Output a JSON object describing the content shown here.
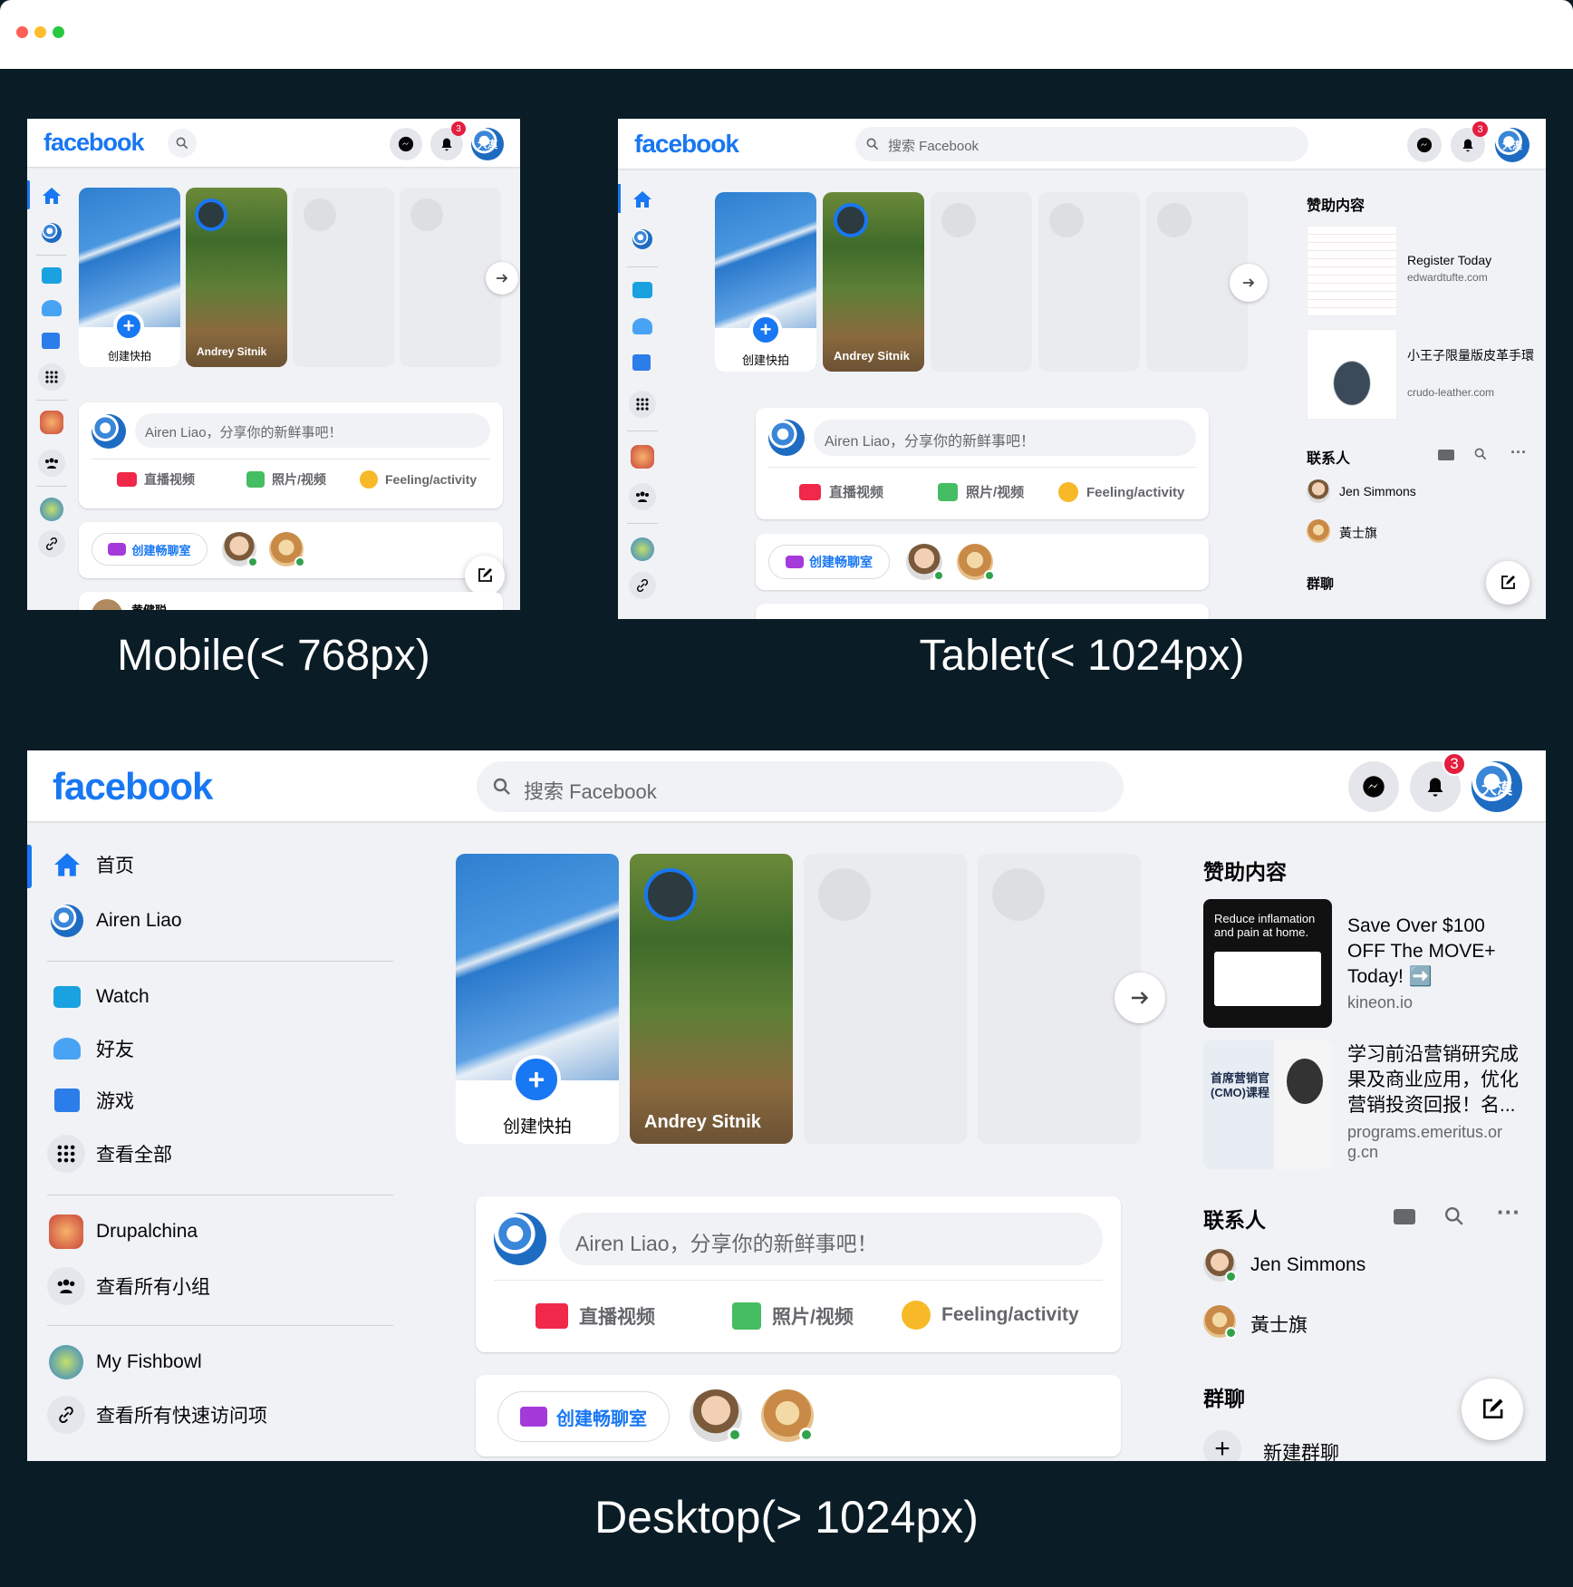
{
  "colors": {
    "brand": "#1877f2",
    "bg_dark": "#0a1c26",
    "page": "#f0f2f5",
    "badge": "#e41e3f",
    "online": "#31a24c"
  },
  "captions": {
    "mobile": "Mobile(< 768px)",
    "tablet": "Tablet(< 1024px)",
    "desktop": "Desktop(> 1024px)"
  },
  "header": {
    "logo": "facebook",
    "search_placeholder": "搜索 Facebook",
    "notif_count": "3",
    "avatar_text": "大漠"
  },
  "stories": {
    "create_label": "创建快拍",
    "friend_name": "Andrey Sitnik"
  },
  "composer": {
    "placeholder": "Airen Liao，分享你的新鲜事吧！",
    "live": "直播视频",
    "photo": "照片/视频",
    "feeling": "Feeling/activity"
  },
  "rooms": {
    "create": "创建畅聊室"
  },
  "sidebar": {
    "items": [
      {
        "label": "首页",
        "icon": "home-icon"
      },
      {
        "label": "Airen Liao",
        "icon": "avatar"
      },
      {
        "label": "Watch",
        "icon": "watch-icon"
      },
      {
        "label": "好友",
        "icon": "friends-icon"
      },
      {
        "label": "游戏",
        "icon": "gaming-icon"
      },
      {
        "label": "查看全部",
        "icon": "grid-icon"
      },
      {
        "label": "Drupalchina",
        "icon": "group-avatar"
      },
      {
        "label": "查看所有小组",
        "icon": "groups-icon"
      },
      {
        "label": "My Fishbowl",
        "icon": "fishbowl-avatar"
      },
      {
        "label": "查看所有快速访问项",
        "icon": "link-icon"
      }
    ]
  },
  "right": {
    "sponsored_title": "赞助内容",
    "ads_tablet": [
      {
        "title": "Register Today",
        "domain": "edwardtufte.com"
      },
      {
        "title": "小王子限量版皮革手環",
        "domain": "crudo-leather.com"
      }
    ],
    "ads_desktop": [
      {
        "title": "Save Over $100 OFF The MOVE+ Today! ➡️",
        "domain": "kineon.io",
        "thumb_text": "Reduce inflamation and pain at home."
      },
      {
        "title": "学习前沿营销研究成果及商业应用，优化营销投资回报！名...",
        "domain": "programs.emeritus.or g.cn",
        "thumb_text": "首席营销官 (CMO)课程"
      }
    ],
    "contacts_title": "联系人",
    "contacts": [
      {
        "name": "Jen Simmons"
      },
      {
        "name": "黃士旗"
      }
    ],
    "group_chat_title": "群聊",
    "new_group": "新建群聊"
  },
  "mobile_peek": "黄健聪"
}
